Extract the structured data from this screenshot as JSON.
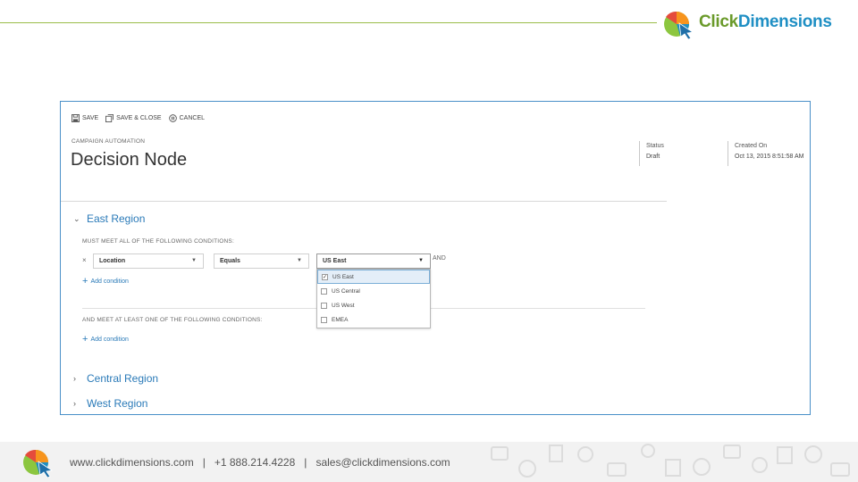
{
  "brand": {
    "part1": "Click",
    "part2": "Dimensions",
    "green": "#6a9a2a",
    "blue": "#1f8fc4"
  },
  "toolbar": {
    "save": "SAVE",
    "save_close": "SAVE & CLOSE",
    "cancel": "CANCEL"
  },
  "record": {
    "entity": "CAMPAIGN AUTOMATION",
    "title": "Decision Node",
    "status_label": "Status",
    "status_value": "Draft",
    "created_label": "Created On",
    "created_value": "Oct 13, 2015 8:51:58 AM"
  },
  "sections": {
    "east": "East Region",
    "central": "Central Region",
    "west": "West Region"
  },
  "conditions": {
    "must_meet_all": "MUST MEET ALL OF THE FOLLOWING CONDITIONS:",
    "and_meet_one": "AND MEET AT LEAST ONE OF THE FOLLOWING CONDITIONS:",
    "remove": "×",
    "field_value": "Location",
    "operator_value": "Equals",
    "region_value": "US East",
    "and_label": "AND",
    "add_condition": "Add condition",
    "add_condition_2": "Add condition"
  },
  "region_options": [
    {
      "label": "US East",
      "checked": true
    },
    {
      "label": "US Central",
      "checked": false
    },
    {
      "label": "US West",
      "checked": false
    },
    {
      "label": "EMEA",
      "checked": false
    }
  ],
  "footer": {
    "website": "www.clickdimensions.com",
    "sep1": "|",
    "phone": "+1 888.214.4228",
    "sep2": "|",
    "email": "sales@clickdimensions.com"
  },
  "colors": {
    "accent": "#2a7ab8",
    "frame": "#4a90c8",
    "header_line": "#9bbd4a"
  }
}
